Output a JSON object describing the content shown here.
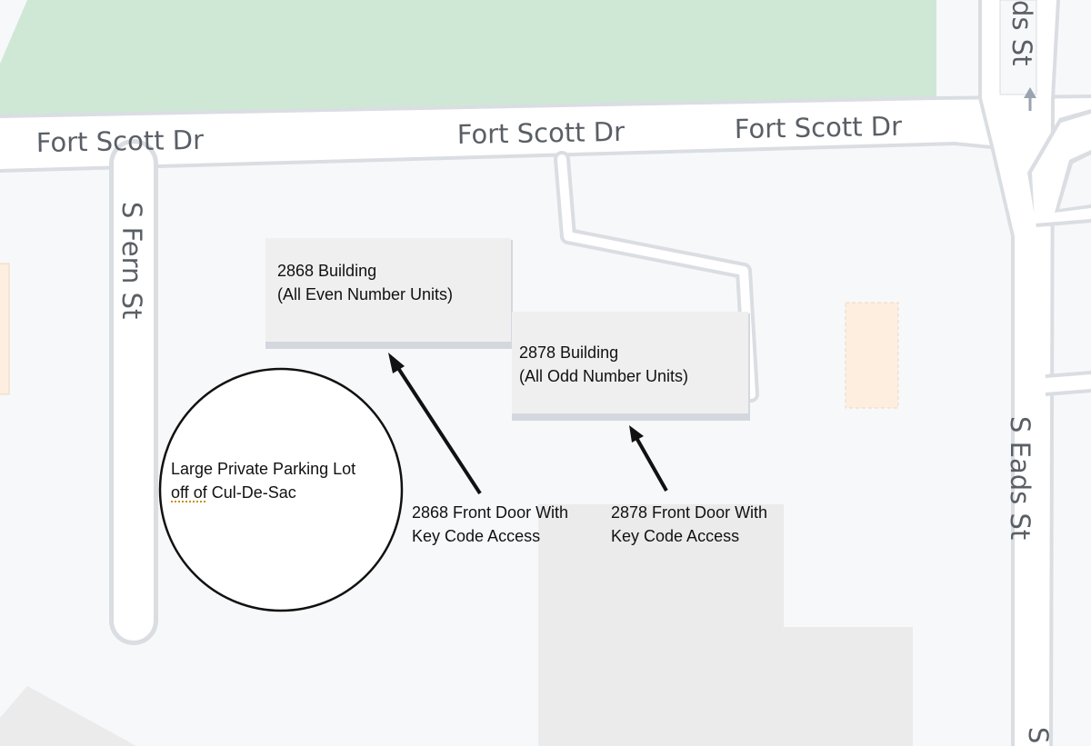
{
  "colors": {
    "background": "#f7f8fa",
    "park": "#cfe8d6",
    "road": "#ffffff",
    "road_edge": "#dadde2",
    "building": "#efeff0",
    "building_shadow": "#d4d8de",
    "lot": "#ebebeb",
    "street_label": "#5a5f66",
    "annotation": "#111111",
    "poi_patch": "#fdeee0"
  },
  "streets": {
    "fort_scott_left": "Fort Scott Dr",
    "fort_scott_mid": "Fort Scott Dr",
    "fort_scott_right": "Fort Scott Dr",
    "s_fern": "S Fern St",
    "s_eads_top": "ds St",
    "s_eads_main": "S Eads St",
    "s_eads_bottom": "S"
  },
  "buildings": {
    "b2868": {
      "line1": "2868 Building",
      "line2": "(All Even Number Units)"
    },
    "b2878": {
      "line1": "2878 Building",
      "line2": "(All Odd Number Units)"
    }
  },
  "parking": {
    "line1": "Large Private Parking Lot",
    "line2_underlined": "off of",
    "line2_rest": " Cul-De-Sac"
  },
  "doors": {
    "d2868": {
      "line1": "2868 Front Door With",
      "line2": "Key Code Access"
    },
    "d2878": {
      "line1": "2878 Front Door With",
      "line2": "Key Code Access"
    }
  },
  "icons": {
    "direction_arrow": "oneway-arrow-up-icon"
  }
}
